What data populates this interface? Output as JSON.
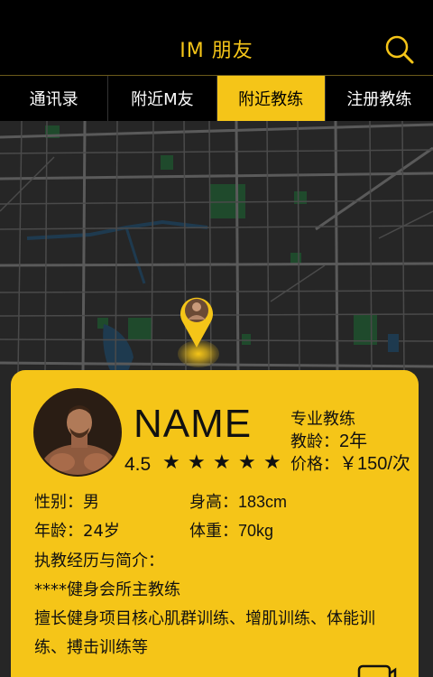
{
  "header": {
    "title": "IM 朋友",
    "icon": "search-icon"
  },
  "tabs": [
    {
      "label": "通讯录",
      "active": false
    },
    {
      "label": "附近M友",
      "active": false
    },
    {
      "label": "附近教练",
      "active": true
    },
    {
      "label": "注册教练",
      "active": false
    }
  ],
  "coach": {
    "name": "NAME",
    "rating": "4.5",
    "stars": 5,
    "role": "专业教练",
    "experience_label": "教龄：",
    "experience_value": "2年",
    "price_label": "价格：",
    "price_value": "￥150/次",
    "gender": "性别：男",
    "height_label": "身高：",
    "height_value": "183cm",
    "age": "年龄：24岁",
    "weight_label": "体重：",
    "weight_value": "70kg",
    "bio_title": "执教经历与简介：",
    "bio_line1": "****健身会所主教练",
    "bio_line2": "擅长健身项目核心肌群训练、增肌训练、体能训练、搏击训练等"
  },
  "colors": {
    "accent": "#f5c518",
    "map_bg": "#262626",
    "road": "#555555",
    "park": "#1f4a2c",
    "water": "#1e3a4f"
  }
}
